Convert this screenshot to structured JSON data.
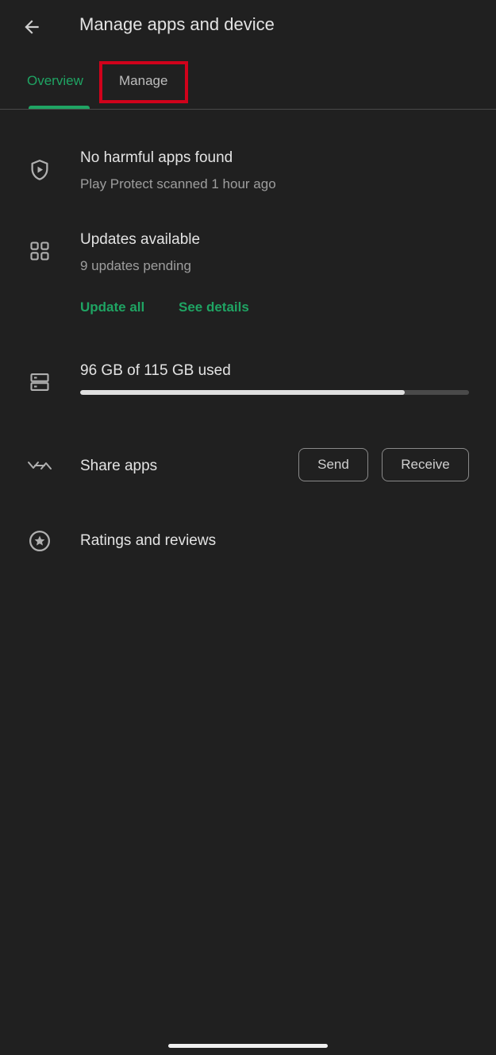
{
  "header": {
    "title": "Manage apps and device",
    "back_icon": "arrow-back-icon"
  },
  "tabs": [
    {
      "label": "Overview",
      "selected": true
    },
    {
      "label": "Manage",
      "selected": false,
      "highlighted": true
    }
  ],
  "colors": {
    "accent": "#1fa463",
    "background": "#202020",
    "highlight_box": "#d0021b"
  },
  "protect": {
    "icon": "shield-play-icon",
    "title": "No harmful apps found",
    "subtitle": "Play Protect scanned 1 hour ago"
  },
  "updates": {
    "icon": "apps-grid-icon",
    "title": "Updates available",
    "subtitle": "9 updates pending",
    "update_all_label": "Update all",
    "see_details_label": "See details"
  },
  "storage": {
    "icon": "storage-icon",
    "label": "96 GB of 115 GB used",
    "used_gb": 96,
    "total_gb": 115
  },
  "share": {
    "icon": "nearby-share-icon",
    "label": "Share apps",
    "send_label": "Send",
    "receive_label": "Receive"
  },
  "ratings": {
    "icon": "star-circle-icon",
    "label": "Ratings and reviews"
  }
}
